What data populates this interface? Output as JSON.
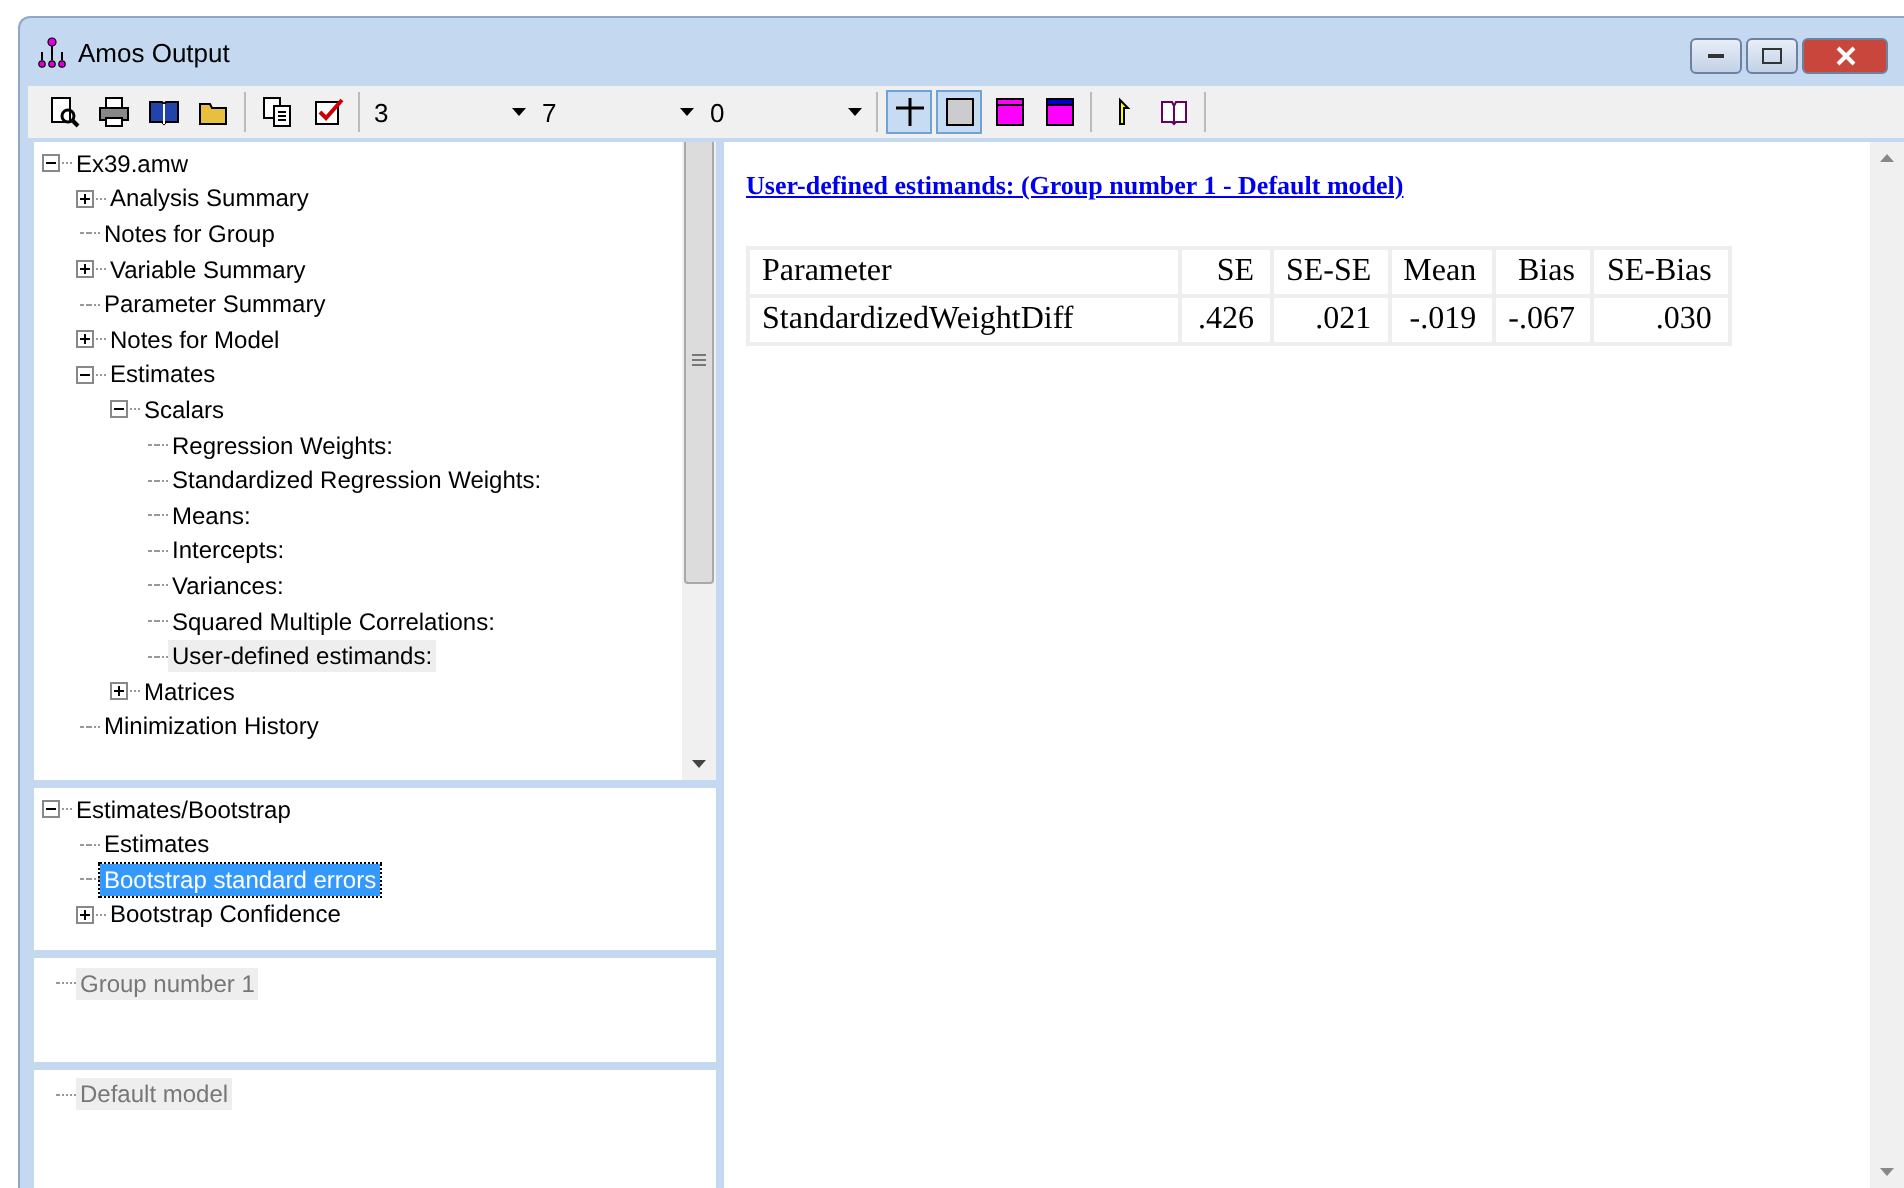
{
  "window": {
    "title": "Amos Output"
  },
  "toolbar": {
    "combos": [
      {
        "value": "3"
      },
      {
        "value": "7"
      },
      {
        "value": "0"
      }
    ],
    "view_buttons": [
      {
        "kind": "grid",
        "pressed": true
      },
      {
        "kind": "box",
        "pressed": true
      },
      {
        "kind": "top",
        "pressed": false
      },
      {
        "kind": "bottom",
        "pressed": false
      }
    ]
  },
  "tree": [
    {
      "label": "Ex39.amw",
      "expanded": true,
      "selected": false,
      "children": [
        {
          "label": "Analysis Summary",
          "expanded": false,
          "selected": false
        },
        {
          "label": "Notes for Group",
          "selected": false
        },
        {
          "label": "Variable Summary",
          "expanded": false,
          "selected": false
        },
        {
          "label": "Parameter Summary",
          "selected": false
        },
        {
          "label": "Notes for Model",
          "expanded": false,
          "selected": false
        },
        {
          "label": "Estimates",
          "expanded": true,
          "selected": false,
          "children": [
            {
              "label": "Scalars",
              "expanded": true,
              "selected": false,
              "children": [
                {
                  "label": "Regression Weights:",
                  "selected": false
                },
                {
                  "label": "Standardized Regression Weights:",
                  "selected": false
                },
                {
                  "label": "Means:",
                  "selected": false
                },
                {
                  "label": "Intercepts:",
                  "selected": false
                },
                {
                  "label": "Variances:",
                  "selected": false
                },
                {
                  "label": "Squared Multiple Correlations:",
                  "selected": false
                },
                {
                  "label": "User-defined estimands:",
                  "selected": true
                }
              ]
            },
            {
              "label": "Matrices",
              "expanded": false,
              "selected": false
            }
          ]
        },
        {
          "label": "Minimization History",
          "selected": false
        }
      ]
    }
  ],
  "bootstrap_tree": [
    {
      "label": "Estimates/Bootstrap",
      "expanded": true,
      "selected": false,
      "children": [
        {
          "label": "Estimates",
          "selected": false
        },
        {
          "label": "Bootstrap standard errors",
          "selected": true
        },
        {
          "label": "Bootstrap Confidence",
          "expanded": false,
          "selected": false
        }
      ]
    }
  ],
  "groups": [
    {
      "label": "Group number 1",
      "selected": true
    }
  ],
  "models": [
    {
      "label": "Default model",
      "selected": true
    }
  ],
  "output": {
    "heading": "User-defined estimands: (Group number 1 - Default model)",
    "table": {
      "columns": [
        "Parameter",
        "SE",
        "SE-SE",
        "Mean",
        "Bias",
        "SE-Bias"
      ],
      "rows": [
        [
          "StandardizedWeightDiff",
          ".426",
          ".021",
          "-.019",
          "-.067",
          ".030"
        ]
      ]
    }
  }
}
